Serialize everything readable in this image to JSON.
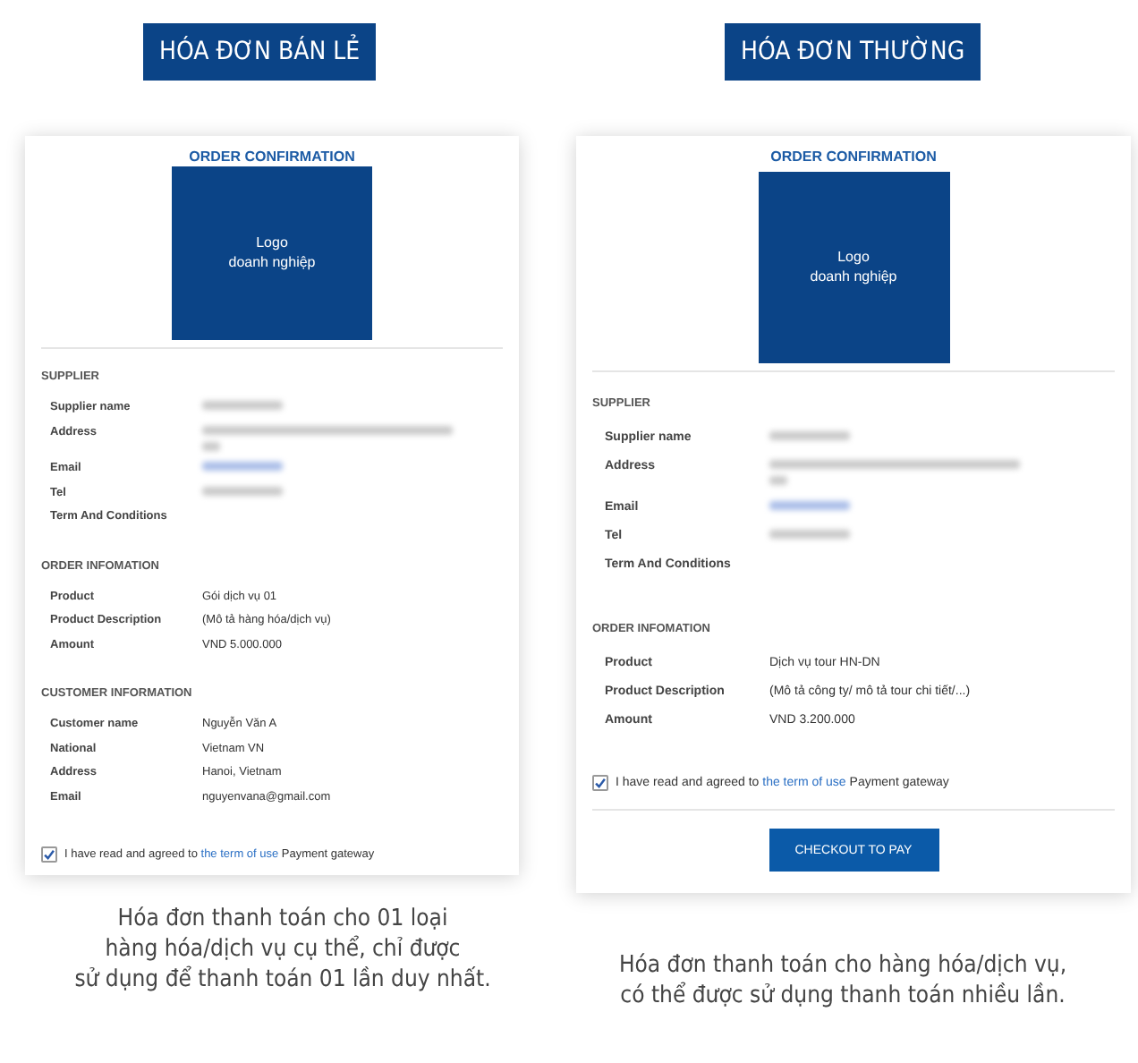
{
  "panels": [
    {
      "heading": "HÓA ĐƠN BÁN LẺ",
      "card": {
        "title": "ORDER CONFIRMATION",
        "logo_lines": [
          "Logo",
          "doanh nghiệp"
        ],
        "sections": [
          {
            "heading": "SUPPLIER",
            "rows": [
              {
                "label": "Supplier name",
                "kind": "blurred"
              },
              {
                "label": "Address",
                "kind": "blurredwrap"
              },
              {
                "label": "Email",
                "kind": "blurredlink"
              },
              {
                "label": "Tel",
                "kind": "blurred"
              },
              {
                "label": "Term And Conditions",
                "kind": "empty"
              }
            ]
          },
          {
            "heading": "ORDER INFOMATION",
            "rows": [
              {
                "label": "Product",
                "kind": "text",
                "value": "Gói dịch vụ 01"
              },
              {
                "label": "Product Description",
                "kind": "text",
                "value": "(Mô tả hàng hóa/dịch vụ)"
              },
              {
                "label": "Amount",
                "kind": "text",
                "value": "VND 5.000.000"
              }
            ]
          },
          {
            "heading": "CUSTOMER INFORMATION",
            "rows": [
              {
                "label": "Customer name",
                "kind": "text",
                "value": "Nguyễn Văn A"
              },
              {
                "label": "National",
                "kind": "text",
                "value": "Vietnam VN"
              },
              {
                "label": "Address",
                "kind": "text",
                "value": "Hanoi, Vietnam"
              },
              {
                "label": "Email",
                "kind": "text",
                "value": "nguyenvana@gmail.com"
              }
            ]
          }
        ],
        "agreement": {
          "checked": true,
          "before": "I have read and agreed to ",
          "link": "the term of use",
          "after": " Payment gateway"
        }
      },
      "caption_lines": [
        "Hóa đơn thanh toán cho 01 loại",
        "hàng hóa/dịch vụ cụ thể, chỉ được",
        "sử dụng để thanh toán 01 lần duy nhất."
      ]
    },
    {
      "heading": "HÓA ĐƠN THƯỜNG",
      "card": {
        "title": "ORDER CONFIRMATION",
        "logo_lines": [
          "Logo",
          "doanh nghiệp"
        ],
        "sections": [
          {
            "heading": "SUPPLIER",
            "rows": [
              {
                "label": "Supplier name",
                "kind": "blurred"
              },
              {
                "label": "Address",
                "kind": "blurredwrap"
              },
              {
                "label": "Email",
                "kind": "blurredlink"
              },
              {
                "label": "Tel",
                "kind": "blurred"
              },
              {
                "label": "Term And Conditions",
                "kind": "empty"
              }
            ]
          },
          {
            "heading": "ORDER INFOMATION",
            "rows": [
              {
                "label": "Product",
                "kind": "text",
                "value": "Dịch vụ tour HN-DN"
              },
              {
                "label": "Product Description",
                "kind": "text",
                "value": "(Mô tả công ty/ mô tả tour chi tiết/...)"
              },
              {
                "label": "Amount",
                "kind": "text",
                "value": "VND 3.200.000"
              }
            ]
          }
        ],
        "agreement": {
          "checked": true,
          "before": "I have read and agreed to ",
          "link": "the term of use",
          "after": " Payment gateway"
        },
        "button": "CHECKOUT TO PAY"
      },
      "caption_lines": [
        "Hóa đơn thanh toán cho hàng hóa/dịch vụ,",
        "có thể được sử dụng thanh toán nhiều lần."
      ]
    }
  ]
}
